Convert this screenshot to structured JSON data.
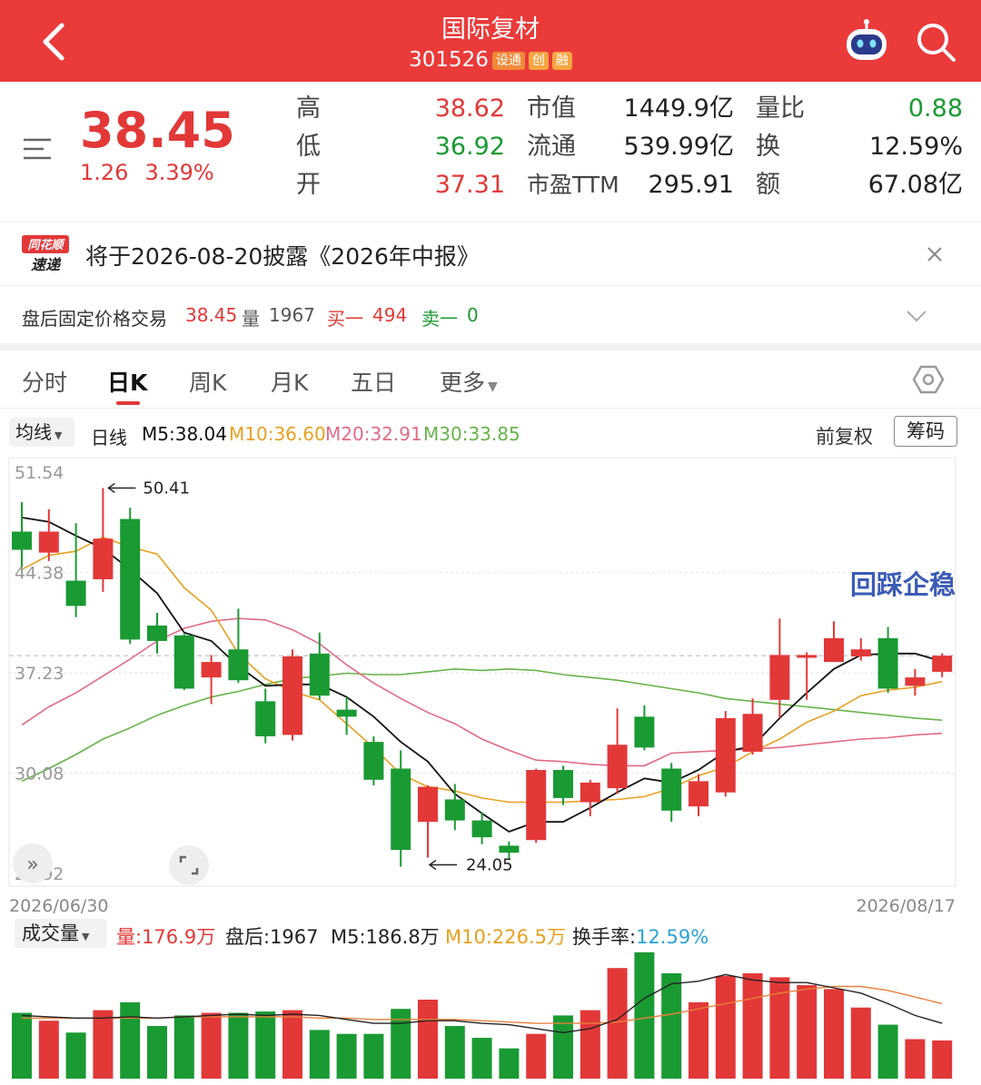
{
  "header": {
    "stock_name": "国际复材",
    "stock_code": "301526",
    "badges": [
      "设通",
      "创",
      "融"
    ]
  },
  "quote": {
    "price": "38.45",
    "change": "1.26",
    "change_pct": "3.39%",
    "high_label": "高",
    "high": "38.62",
    "low_label": "低",
    "low": "36.92",
    "open_label": "开",
    "open": "37.31",
    "mcap_label": "市值",
    "mcap": "1449.9亿",
    "float_label": "流通",
    "float": "539.99亿",
    "pe_label": "市盈TTM",
    "pe": "295.91",
    "vr_label": "量比",
    "vr": "0.88",
    "turnover_label": "换",
    "turnover": "12.59%",
    "amount_label": "额",
    "amount": "67.08亿"
  },
  "notice": {
    "logo_line1": "同花顺",
    "logo_line2": "速递",
    "text": "将于2026-08-20披露《2026年中报》"
  },
  "after_hours": {
    "label": "盘后固定价格交易",
    "price": "38.45",
    "vol_label": "量",
    "vol": "1967",
    "buy_label": "买一",
    "buy": "494",
    "sell_label": "卖一",
    "sell": "0"
  },
  "tabs": [
    "分时",
    "日K",
    "周K",
    "月K",
    "五日",
    "更多"
  ],
  "ma": {
    "select_label": "均线",
    "period_label": "日线",
    "m5": "M5:38.04",
    "m10": "M10:36.60",
    "m20": "M20:32.91",
    "m30": "M30:33.85",
    "adjust_label": "前复权",
    "chip_button": "筹码"
  },
  "volume_header": {
    "select_label": "成交量",
    "vol": "量:176.9万",
    "after": "盘后:1967",
    "m5": "M5:186.8万",
    "m10": "M10:226.5万",
    "turnover": "换手率:12.59%"
  },
  "colors": {
    "up": "#e23838",
    "down": "#1a9a33",
    "ma5": "#111111",
    "ma10": "#e8a020",
    "ma20": "#e06b87",
    "ma30": "#68b34a",
    "annotation": "#3b5bb5"
  },
  "chart_data": {
    "type": "candlestick",
    "x_start_label": "2026/06/30",
    "x_end_label": "2026/08/17",
    "y_ticks": [
      "51.54",
      "44.38",
      "37.23",
      "30.08",
      "22.92"
    ],
    "ylim": [
      22.92,
      51.54
    ],
    "max_marker": "50.41",
    "min_marker": "24.05",
    "annotation": "回踩企稳",
    "candles": [
      {
        "o": 47.3,
        "c": 46.0,
        "h": 49.4,
        "l": 44.4
      },
      {
        "o": 45.8,
        "c": 47.3,
        "h": 48.9,
        "l": 45.2
      },
      {
        "o": 43.8,
        "c": 42.0,
        "h": 47.9,
        "l": 41.2
      },
      {
        "o": 43.9,
        "c": 46.8,
        "h": 50.41,
        "l": 43.0
      },
      {
        "o": 48.2,
        "c": 39.6,
        "h": 49.0,
        "l": 39.3
      },
      {
        "o": 40.6,
        "c": 39.5,
        "h": 41.5,
        "l": 38.6
      },
      {
        "o": 39.9,
        "c": 36.1,
        "h": 40.0,
        "l": 36.0
      },
      {
        "o": 36.9,
        "c": 38.0,
        "h": 38.5,
        "l": 35.0
      },
      {
        "o": 38.9,
        "c": 36.7,
        "h": 41.8,
        "l": 36.5
      },
      {
        "o": 35.2,
        "c": 32.7,
        "h": 36.1,
        "l": 32.2
      },
      {
        "o": 32.8,
        "c": 38.4,
        "h": 38.9,
        "l": 32.4
      },
      {
        "o": 38.6,
        "c": 35.6,
        "h": 40.1,
        "l": 35.3
      },
      {
        "o": 34.6,
        "c": 34.1,
        "h": 35.5,
        "l": 32.8
      },
      {
        "o": 32.3,
        "c": 29.6,
        "h": 32.7,
        "l": 29.2
      },
      {
        "o": 30.4,
        "c": 24.6,
        "h": 31.7,
        "l": 23.4
      },
      {
        "o": 26.6,
        "c": 29.1,
        "h": 29.2,
        "l": 24.05
      },
      {
        "o": 28.2,
        "c": 26.7,
        "h": 29.3,
        "l": 26.0
      },
      {
        "o": 26.7,
        "c": 25.5,
        "h": 27.3,
        "l": 25.0
      },
      {
        "o": 24.9,
        "c": 24.4,
        "h": 25.2,
        "l": 24.0
      },
      {
        "o": 25.3,
        "c": 30.3,
        "h": 30.4,
        "l": 25.1
      },
      {
        "o": 30.3,
        "c": 28.3,
        "h": 30.6,
        "l": 27.8
      },
      {
        "o": 28.0,
        "c": 29.4,
        "h": 29.6,
        "l": 27.0
      },
      {
        "o": 29.0,
        "c": 32.1,
        "h": 34.7,
        "l": 28.6
      },
      {
        "o": 34.1,
        "c": 31.9,
        "h": 34.9,
        "l": 31.7
      },
      {
        "o": 30.4,
        "c": 27.4,
        "h": 30.8,
        "l": 26.6
      },
      {
        "o": 27.7,
        "c": 29.5,
        "h": 30.0,
        "l": 27.0
      },
      {
        "o": 28.7,
        "c": 34.0,
        "h": 34.5,
        "l": 28.4
      },
      {
        "o": 31.6,
        "c": 34.3,
        "h": 35.4,
        "l": 31.4
      },
      {
        "o": 35.3,
        "c": 38.5,
        "h": 41.1,
        "l": 34.0
      },
      {
        "o": 38.3,
        "c": 38.5,
        "h": 38.7,
        "l": 35.3
      },
      {
        "o": 38.0,
        "c": 39.7,
        "h": 40.9,
        "l": 38.0
      },
      {
        "o": 38.4,
        "c": 38.9,
        "h": 39.7,
        "l": 38.1
      },
      {
        "o": 39.7,
        "c": 36.1,
        "h": 40.5,
        "l": 35.8
      },
      {
        "o": 36.3,
        "c": 36.9,
        "h": 37.5,
        "l": 35.6
      },
      {
        "o": 37.3,
        "c": 38.45,
        "h": 38.62,
        "l": 36.92
      }
    ],
    "ma5": [
      48.3,
      48.0,
      47.0,
      46.1,
      44.6,
      42.9,
      40.1,
      39.5,
      37.7,
      36.3,
      36.4,
      36.4,
      35.5,
      34.1,
      32.3,
      30.9,
      28.6,
      27.2,
      25.9,
      26.6,
      26.6,
      27.6,
      28.7,
      29.7,
      29.4,
      30.3,
      31.6,
      32.0,
      34.0,
      35.8,
      37.5,
      38.5,
      38.6,
      38.6,
      38.04
    ],
    "ma10": [
      44.6,
      45.6,
      45.9,
      46.9,
      46.2,
      45.7,
      43.3,
      41.7,
      38.6,
      36.8,
      35.9,
      35.3,
      33.6,
      31.9,
      30.0,
      29.1,
      28.8,
      28.3,
      28.0,
      28.0,
      28.0,
      28.1,
      28.2,
      28.4,
      29.0,
      29.9,
      30.5,
      31.6,
      32.5,
      33.7,
      34.5,
      35.6,
      36.0,
      36.2,
      36.6
    ],
    "ma20": [
      33.5,
      34.8,
      35.8,
      37.0,
      38.2,
      39.5,
      40.4,
      40.9,
      41.1,
      41.0,
      40.3,
      39.3,
      37.8,
      36.5,
      35.4,
      34.4,
      33.6,
      32.5,
      31.7,
      31.0,
      30.9,
      30.7,
      30.6,
      30.6,
      31.5,
      31.6,
      31.7,
      31.8,
      31.9,
      32.1,
      32.3,
      32.5,
      32.6,
      32.8,
      32.91
    ],
    "ma30": [
      29.5,
      30.4,
      31.4,
      32.5,
      33.3,
      34.2,
      34.9,
      35.5,
      35.9,
      36.4,
      36.8,
      37.0,
      37.2,
      37.1,
      37.1,
      37.3,
      37.5,
      37.4,
      37.5,
      37.4,
      37.1,
      36.9,
      36.7,
      36.4,
      36.1,
      35.8,
      35.4,
      35.2,
      35.0,
      34.8,
      34.6,
      34.4,
      34.2,
      34.0,
      33.85
    ],
    "volumes": [
      0.5,
      0.44,
      0.35,
      0.52,
      0.58,
      0.4,
      0.48,
      0.5,
      0.5,
      0.51,
      0.52,
      0.37,
      0.34,
      0.34,
      0.53,
      0.6,
      0.4,
      0.31,
      0.23,
      0.34,
      0.48,
      0.52,
      0.84,
      0.96,
      0.8,
      0.58,
      0.78,
      0.8,
      0.77,
      0.71,
      0.68,
      0.54,
      0.41,
      0.3,
      0.29
    ],
    "vol_ma5": [
      0.48,
      0.47,
      0.46,
      0.46,
      0.47,
      0.46,
      0.47,
      0.48,
      0.49,
      0.48,
      0.49,
      0.48,
      0.45,
      0.42,
      0.42,
      0.44,
      0.44,
      0.42,
      0.41,
      0.38,
      0.35,
      0.38,
      0.45,
      0.61,
      0.72,
      0.74,
      0.79,
      0.75,
      0.73,
      0.73,
      0.69,
      0.65,
      0.57,
      0.48,
      0.42
    ],
    "vol_ma10": [
      0.46,
      0.46,
      0.46,
      0.46,
      0.46,
      0.46,
      0.47,
      0.47,
      0.47,
      0.47,
      0.47,
      0.46,
      0.46,
      0.45,
      0.45,
      0.45,
      0.45,
      0.44,
      0.43,
      0.42,
      0.42,
      0.42,
      0.43,
      0.46,
      0.49,
      0.53,
      0.57,
      0.61,
      0.65,
      0.68,
      0.7,
      0.7,
      0.67,
      0.62,
      0.57
    ]
  }
}
